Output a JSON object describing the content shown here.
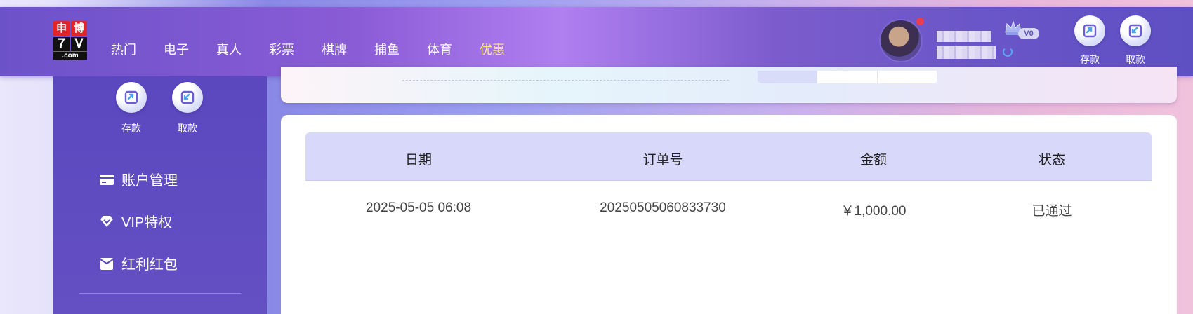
{
  "logo": {
    "top_chars": [
      "申",
      "博"
    ],
    "mid_chars": [
      "7",
      "V"
    ],
    "bottom_text": ".com"
  },
  "nav": {
    "items": [
      {
        "label": "热门"
      },
      {
        "label": "电子"
      },
      {
        "label": "真人"
      },
      {
        "label": "彩票"
      },
      {
        "label": "棋牌"
      },
      {
        "label": "捕鱼"
      },
      {
        "label": "体育"
      },
      {
        "label": "优惠",
        "active": true
      }
    ]
  },
  "user": {
    "vip_level": "V0",
    "avatar_icon": "avatar-icon",
    "refresh_icon": "refresh-icon"
  },
  "header_actions": {
    "deposit_label": "存款",
    "withdraw_label": "取款"
  },
  "sidebar": {
    "deposit_label": "存款",
    "withdraw_label": "取款",
    "items": [
      {
        "label": "账户管理",
        "icon": "card-icon"
      },
      {
        "label": "VIP特权",
        "icon": "diamond-icon"
      },
      {
        "label": "红利红包",
        "icon": "envelope-icon"
      }
    ]
  },
  "table": {
    "columns": [
      "日期",
      "订单号",
      "金额",
      "状态"
    ],
    "rows": [
      {
        "date": "2025-05-05 06:08",
        "order": "20250505060833730",
        "amount": "￥1,000.00",
        "status": "已通过"
      }
    ]
  },
  "colors": {
    "header_start": "#6c52c9",
    "header_mid": "#b07ff0",
    "sidebar": "#5b48bf",
    "table_head": "#d8d8fb",
    "active_nav": "#ffe58a"
  }
}
